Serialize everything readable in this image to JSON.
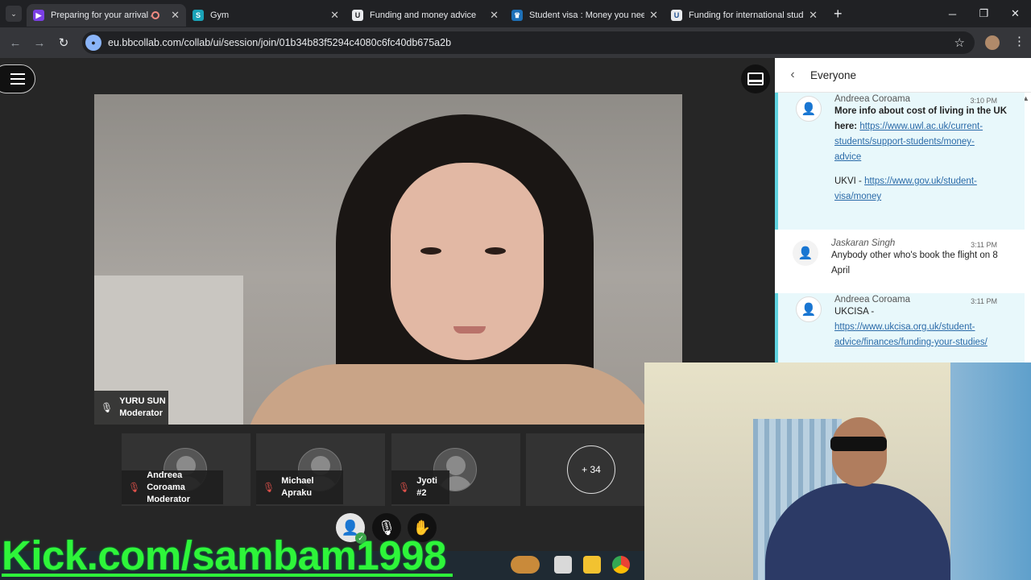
{
  "browser": {
    "tabs": [
      {
        "title": "Preparing for your arrival &",
        "active": true,
        "recording": true,
        "favicon": "collab-icon"
      },
      {
        "title": "Gym",
        "active": false,
        "favicon": "su-icon"
      },
      {
        "title": "Funding and money advice",
        "active": false,
        "favicon": "university-icon"
      },
      {
        "title": "Student visa : Money you need",
        "active": false,
        "favicon": "govuk-icon"
      },
      {
        "title": "Funding for international stude",
        "active": false,
        "favicon": "ukcisa-icon"
      }
    ],
    "url": "eu.bbcollab.com/collab/ui/session/join/01b34b83f5294c4080c6fc40db675a2b",
    "window_controls": [
      "─",
      "❐",
      "✕"
    ]
  },
  "session": {
    "presenter": {
      "name": "YURU SUN",
      "role": "Moderator"
    },
    "participants": [
      {
        "name": "Andreea Coroama",
        "role": "Moderator",
        "muted": true
      },
      {
        "name": "Michael Apraku",
        "role": "",
        "muted": true
      },
      {
        "name": "Jyoti #2",
        "role": "",
        "muted": true
      }
    ],
    "more_count": "+ 34"
  },
  "chat": {
    "title": "Everyone",
    "messages": [
      {
        "sender": "Andreea Coroama",
        "time": "3:10 PM",
        "bold_text": "More info about cost of living in the UK",
        "bold_prefix": "here:",
        "link1": "https://www.uwl.ac.uk/current-students/support-students/money-advice",
        "link1_lines": [
          "https://www.uwl.ac.uk/current-",
          "students/support-students/money-",
          "advice"
        ],
        "label2": "UKVI -",
        "link2_lines": [
          "https://www.gov.uk/student-",
          "visa/money"
        ]
      },
      {
        "sender": "Jaskaran Singh",
        "time": "3:11 PM",
        "text": "Anybody other who's book the flight on 8 April"
      },
      {
        "sender": "Andreea Coroama",
        "time": "3:11 PM",
        "label": "UKCISA -",
        "link_lines": [
          "https://www.ukcisa.org.uk/student-",
          "advice/finances/funding-your-studies/"
        ]
      }
    ]
  },
  "overlay": {
    "kick_text": "Kick.com/sambam1998",
    "accent": "#2ef53a"
  },
  "colors": {
    "chat_highlight": "#e8f8fb",
    "chat_border": "#5fd3e0",
    "link": "#2a6aa8",
    "mute": "#e0504a"
  }
}
